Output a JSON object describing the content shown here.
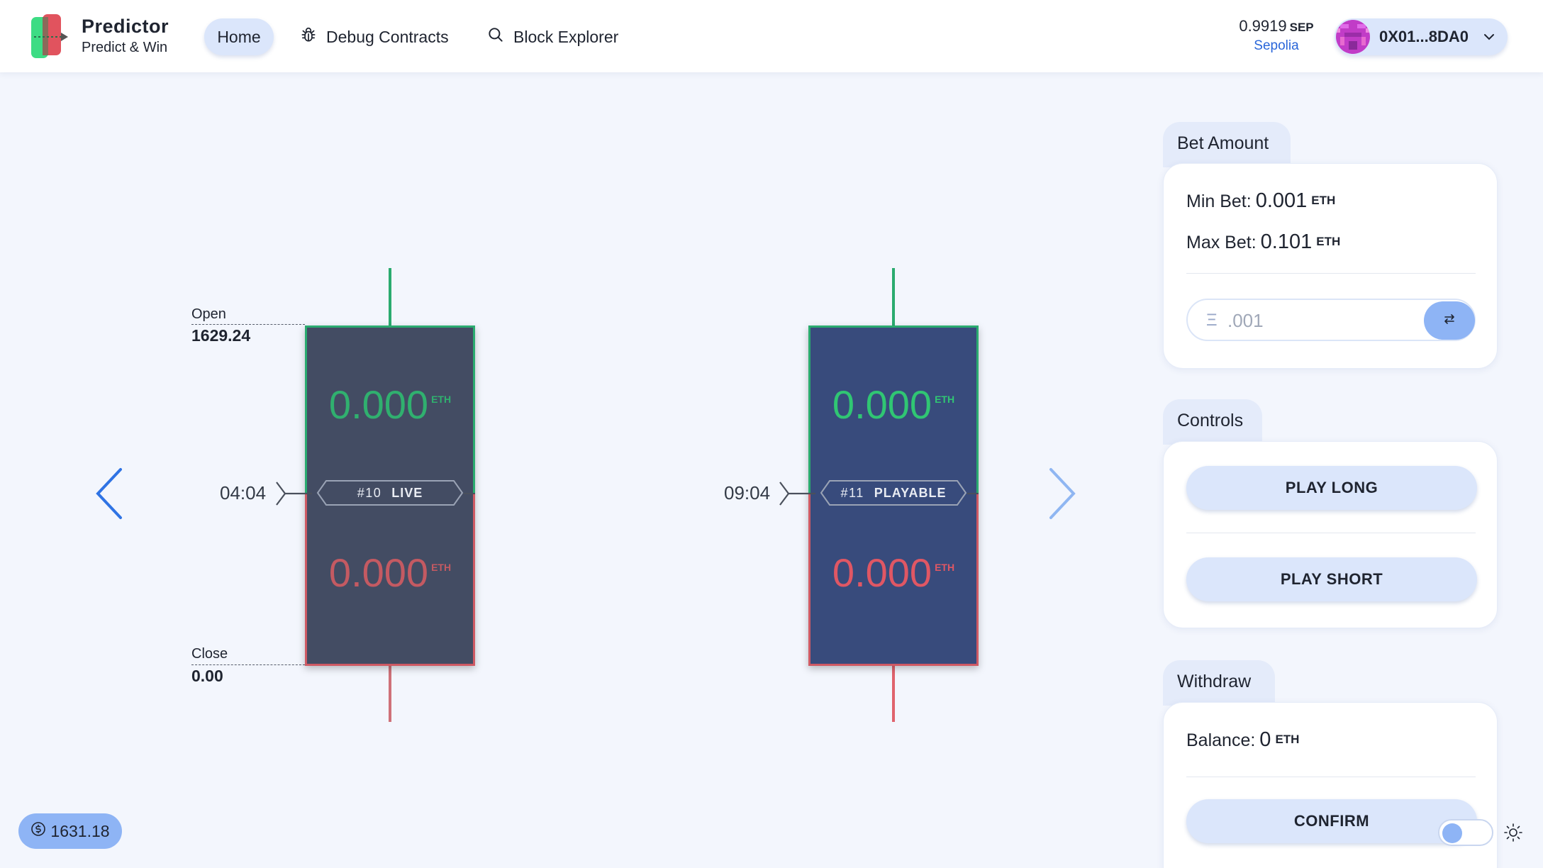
{
  "header": {
    "brand_title": "Predictor",
    "brand_subtitle": "Predict & Win",
    "nav": {
      "home": "Home",
      "debug": "Debug Contracts",
      "explorer": "Block Explorer"
    },
    "balance": {
      "amount": "0.9919",
      "unit": "SEP",
      "network": "Sepolia"
    },
    "wallet": {
      "address": "0X01...8DA0"
    }
  },
  "chart": {
    "open_label": "Open",
    "open_value": "1629.24",
    "close_label": "Close",
    "close_value": "0.00"
  },
  "rounds": [
    {
      "time": "04:04",
      "id": "#10",
      "state": "LIVE",
      "long_amount": "0.000",
      "short_amount": "0.000",
      "unit": "ETH"
    },
    {
      "time": "09:04",
      "id": "#11",
      "state": "PLAYABLE",
      "long_amount": "0.000",
      "short_amount": "0.000",
      "unit": "ETH"
    }
  ],
  "bet_panel": {
    "title": "Bet Amount",
    "min_label": "Min Bet:",
    "min_value": "0.001",
    "max_label": "Max Bet:",
    "max_value": "0.101",
    "unit": "ETH",
    "input_prefix": "Ξ",
    "input_value": ".001"
  },
  "controls_panel": {
    "title": "Controls",
    "play_long": "PLAY LONG",
    "play_short": "PLAY SHORT"
  },
  "withdraw_panel": {
    "title": "Withdraw",
    "balance_label": "Balance:",
    "balance_value": "0",
    "unit": "ETH",
    "confirm": "CONFIRM"
  },
  "footer": {
    "price": "1631.18"
  },
  "colors": {
    "accent": "#8eb4f5",
    "long": "#30c673",
    "short": "#e05764",
    "link": "#2a66d9"
  }
}
